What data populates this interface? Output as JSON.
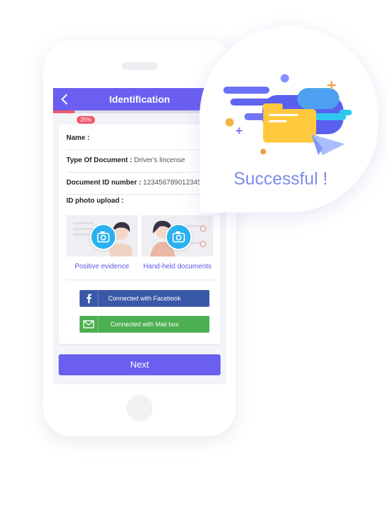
{
  "app": {
    "title": "Identification",
    "progress_percent": 25,
    "progress_label": "25%"
  },
  "form": {
    "name_label": "Name :",
    "doc_type_label": "Type Of Document :",
    "doc_type_value": "Driver's lincense",
    "doc_id_label": "Document ID number :",
    "doc_id_value": "123456789012345",
    "upload_label": "ID photo upload :",
    "photo_1_caption": "Positive evidence",
    "photo_2_caption": "Hand-held documents"
  },
  "buttons": {
    "facebook": "Connected with Facebook",
    "mailbox": "Connected with Mail box",
    "next": "Next"
  },
  "bubble": {
    "message": "Successful !"
  },
  "icons": [
    "back-chevron-icon",
    "camera-icon",
    "facebook-icon",
    "mail-icon",
    "folder-icon",
    "paper-plane-icon"
  ],
  "colors": {
    "primary": "#6a5ff0",
    "progress": "#f05a6a",
    "facebook": "#3a58a8",
    "mail": "#4caf50",
    "camera": "#2ab1f0",
    "success_text": "#7b8cea"
  }
}
